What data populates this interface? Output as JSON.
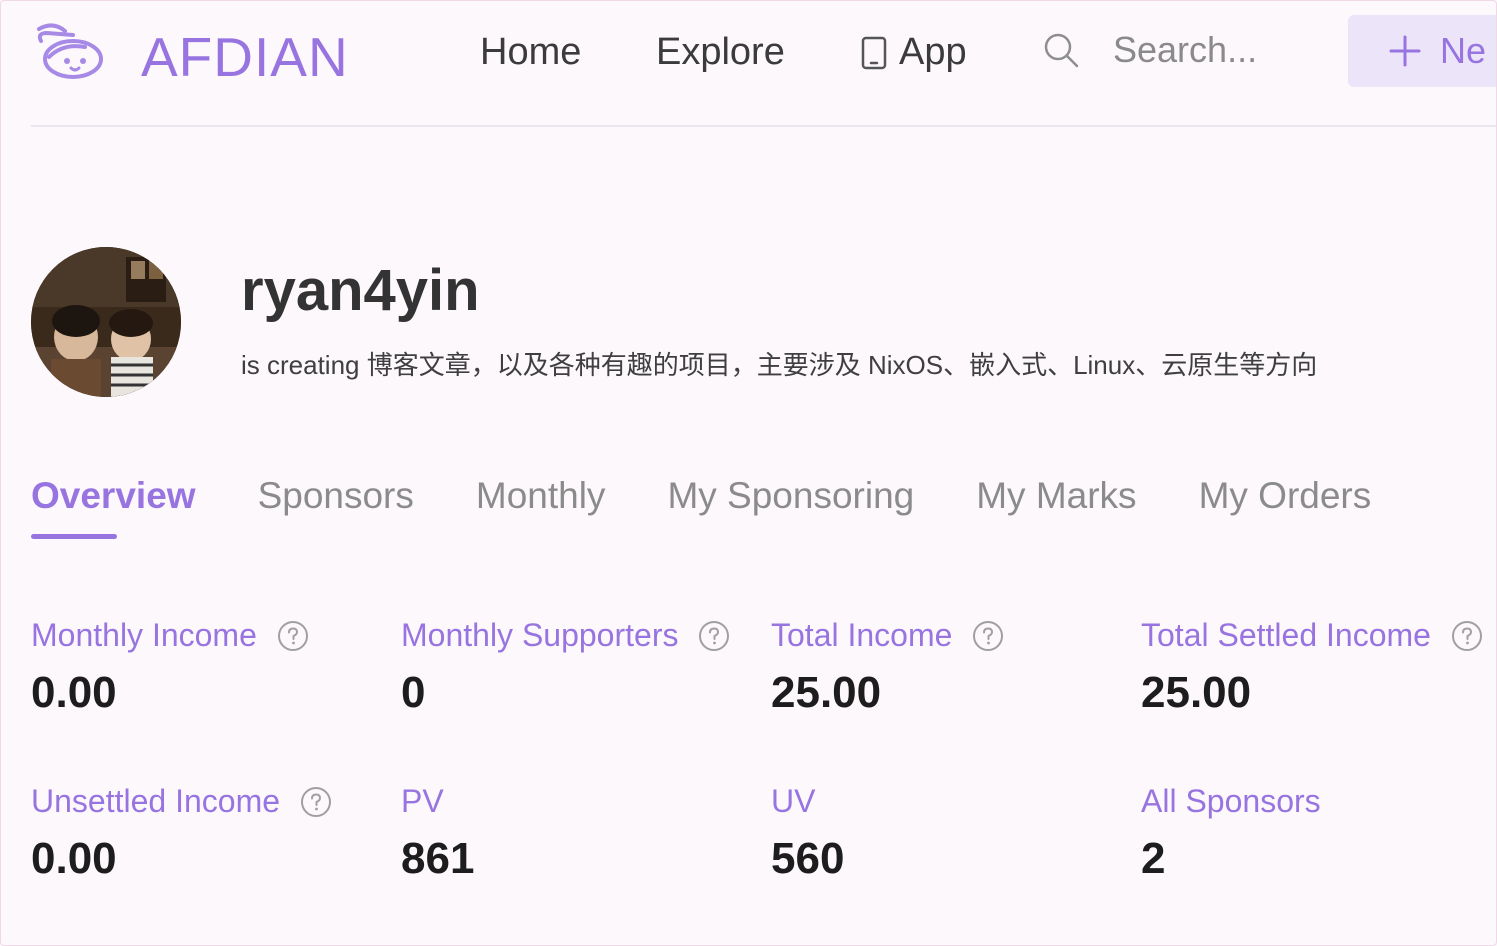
{
  "brand": {
    "name": "AFDIAN",
    "accent": "#9874e0"
  },
  "nav": {
    "home": "Home",
    "explore": "Explore",
    "app": "App",
    "search_placeholder": "Search...",
    "new_button": "Ne"
  },
  "profile": {
    "username": "ryan4yin",
    "bio": "is creating 博客文章，以及各种有趣的项目，主要涉及 NixOS、嵌入式、Linux、云原生等方向"
  },
  "tabs": [
    "Overview",
    "Sponsors",
    "Monthly",
    "My Sponsoring",
    "My Marks",
    "My Orders"
  ],
  "active_tab": "Overview",
  "stats": [
    {
      "label": "Monthly Income",
      "value": "0.00",
      "help": true
    },
    {
      "label": "Monthly Supporters",
      "value": "0",
      "help": true
    },
    {
      "label": "Total Income",
      "value": "25.00",
      "help": true
    },
    {
      "label": "Total Settled Income",
      "value": "25.00",
      "help": true
    },
    {
      "label": "Unsettled Income",
      "value": "0.00",
      "help": true
    },
    {
      "label": "PV",
      "value": "861",
      "help": false
    },
    {
      "label": "UV",
      "value": "560",
      "help": false
    },
    {
      "label": "All Sponsors",
      "value": "2",
      "help": false
    }
  ],
  "icons": {
    "logo": "afdian-logo-icon",
    "app": "phone-icon",
    "search": "search-icon",
    "new": "plus-icon",
    "help": "help-circle-icon"
  }
}
